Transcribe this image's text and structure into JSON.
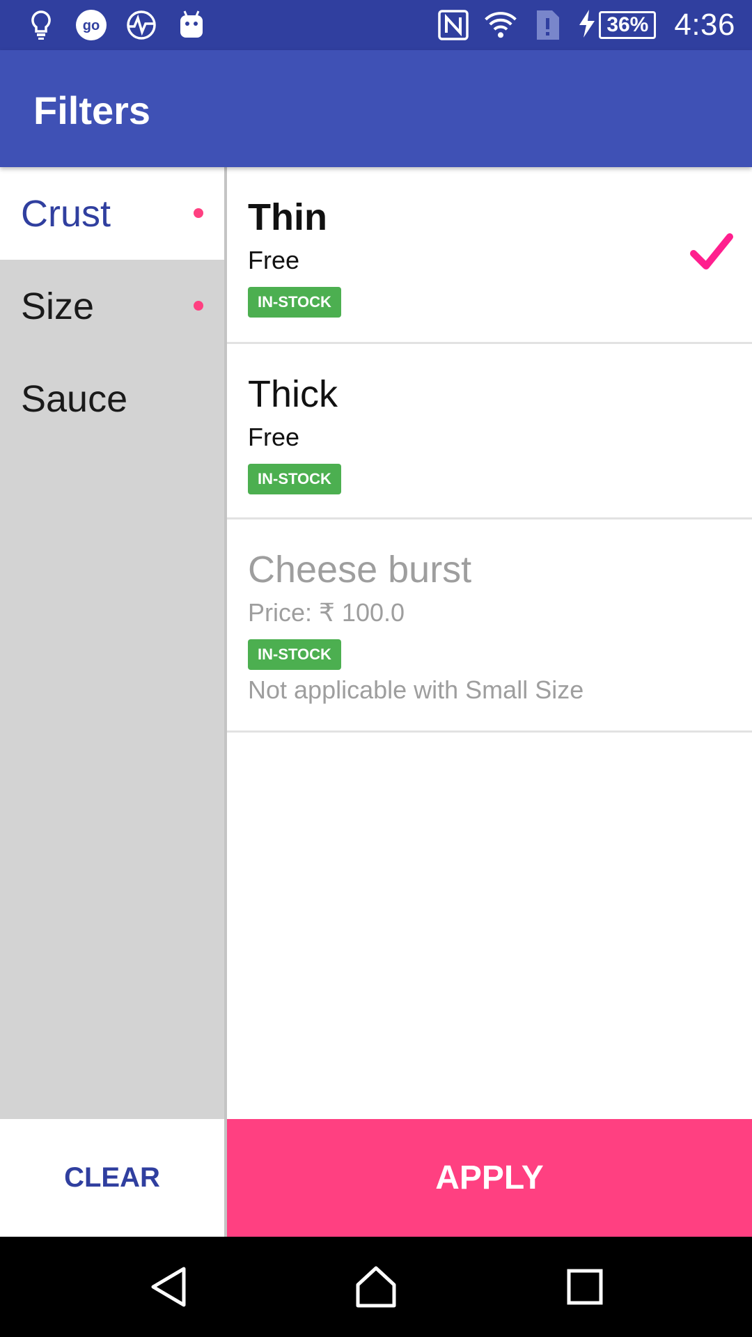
{
  "status_bar": {
    "battery": "36%",
    "time": "4:36",
    "icons": [
      "bulb-icon",
      "go-icon",
      "pulse-icon",
      "android-icon",
      "nfc-icon",
      "wifi-icon",
      "sim-alert-icon",
      "charging-icon"
    ]
  },
  "app_bar": {
    "title": "Filters"
  },
  "categories": [
    {
      "label": "Crust",
      "selected": true,
      "has_selection": true
    },
    {
      "label": "Size",
      "selected": false,
      "has_selection": true
    },
    {
      "label": "Sauce",
      "selected": false,
      "has_selection": false
    }
  ],
  "options": [
    {
      "name": "Thin",
      "price": "Free",
      "badge": "IN-STOCK",
      "checked": true,
      "disabled": false,
      "note": ""
    },
    {
      "name": "Thick",
      "price": "Free",
      "badge": "IN-STOCK",
      "checked": false,
      "disabled": false,
      "note": ""
    },
    {
      "name": "Cheese burst",
      "price": "Price: ₹ 100.0",
      "badge": "IN-STOCK",
      "checked": false,
      "disabled": true,
      "note": "Not applicable with Small Size"
    }
  ],
  "actions": {
    "clear": "CLEAR",
    "apply": "APPLY"
  },
  "nav": [
    "back-icon",
    "home-icon",
    "recents-icon"
  ],
  "colors": {
    "primary": "#3F51B5",
    "primary_dark": "#303F9F",
    "accent": "#FF4081",
    "badge": "#4CAF50"
  }
}
